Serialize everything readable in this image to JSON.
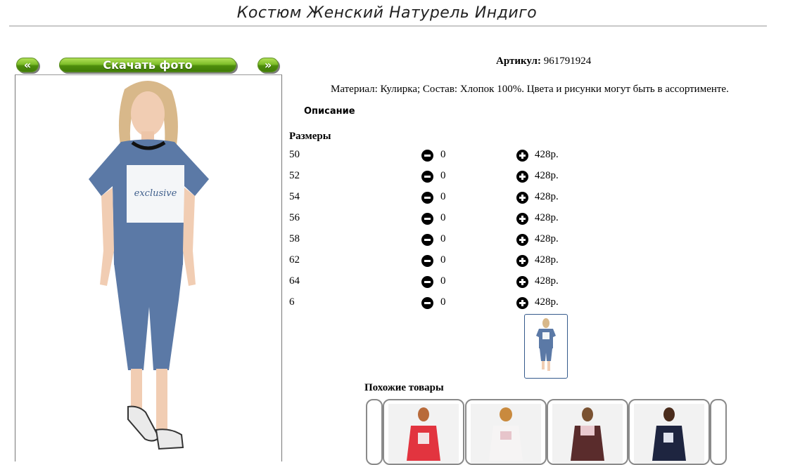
{
  "page": {
    "title": "Костюм Женский Натурель Индиго"
  },
  "gallery": {
    "prev_label": "«",
    "download_label": "Скачать фото",
    "next_label": "»"
  },
  "product": {
    "article_label": "Артикул:",
    "article_value": "961791924",
    "material_text": "Материал: Кулирка; Состав: Хлопок 100%. Цвета и рисунки могут быть в ассортименте.",
    "description_label": "Описание",
    "sizes_label": "Размеры",
    "sizes": [
      {
        "size": "50",
        "qty": "0",
        "price": "428р."
      },
      {
        "size": "52",
        "qty": "0",
        "price": "428р."
      },
      {
        "size": "54",
        "qty": "0",
        "price": "428р."
      },
      {
        "size": "56",
        "qty": "0",
        "price": "428р."
      },
      {
        "size": "58",
        "qty": "0",
        "price": "428р."
      },
      {
        "size": "62",
        "qty": "0",
        "price": "428р."
      },
      {
        "size": "64",
        "qty": "0",
        "price": "428р."
      },
      {
        "size": "6",
        "qty": "0",
        "price": "428р."
      }
    ]
  },
  "similar": {
    "label": "Похожие товары"
  },
  "colors": {
    "accent_green": "#5fa01c",
    "outfit_blue": "#5b79a6",
    "title_rule": "#c9c9c9"
  }
}
